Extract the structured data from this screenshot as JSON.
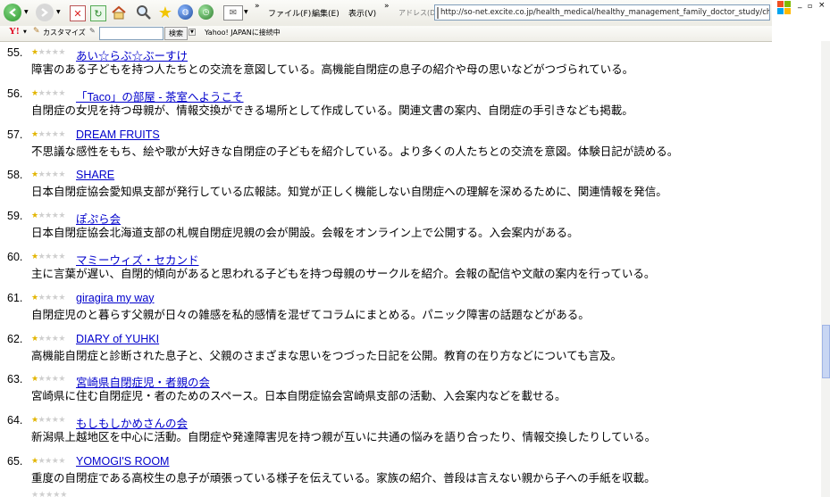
{
  "toolbar": {
    "menus": [
      "ファイル(F)",
      "編集(E)",
      "表示(V)"
    ],
    "address_label": "アドレス(D)",
    "address_url": "http://so-net.excite.co.jp/health_medical/healthy_management_family_doctor_study/chik",
    "customize_label": "カスタマイズ",
    "search_button": "検索",
    "yahoo_status": "Yahoo! JAPANに接続中"
  },
  "entries": [
    {
      "num": "55.",
      "rating": 1,
      "title": "あい☆らぶ☆ぶーすけ",
      "desc": "障害のある子どもを持つ人たちとの交流を意図している。高機能自閉症の息子の紹介や母の思いなどがつづられている。"
    },
    {
      "num": "56.",
      "rating": 1,
      "title": "「Taco」の部屋 ‐ 茶室へようこそ",
      "desc": "自閉症の女児を持つ母親が、情報交換ができる場所として作成している。関連文書の案内、自閉症の手引きなども掲載。"
    },
    {
      "num": "57.",
      "rating": 1,
      "title": "DREAM FRUITS",
      "desc": "不思議な感性をもち、絵や歌が大好きな自閉症の子どもを紹介している。より多くの人たちとの交流を意図。体験日記が読める。"
    },
    {
      "num": "58.",
      "rating": 1,
      "title": "SHARE",
      "desc": "日本自閉症協会愛知県支部が発行している広報誌。知覚が正しく機能しない自閉症への理解を深めるために、関連情報を発信。"
    },
    {
      "num": "59.",
      "rating": 1,
      "title": "ぽぷら会",
      "desc": "日本自閉症協会北海道支部の札幌自閉症児親の会が開設。会報をオンライン上で公開する。入会案内がある。"
    },
    {
      "num": "60.",
      "rating": 1,
      "title": "マミーウィズ・セカンド",
      "desc": "主に言葉が遅い、自閉的傾向があると思われる子どもを持つ母親のサークルを紹介。会報の配信や文献の案内を行っている。"
    },
    {
      "num": "61.",
      "rating": 1,
      "title": "giragira my way",
      "desc": "自閉症児のと暮らす父親が日々の雑感を私的感情を混ぜてコラムにまとめる。パニック障害の話題などがある。"
    },
    {
      "num": "62.",
      "rating": 1,
      "title": "DIARY of YUHKI",
      "desc": "高機能自閉症と診断された息子と、父親のさまざまな思いをつづった日記を公開。教育の在り方などについても言及。"
    },
    {
      "num": "63.",
      "rating": 1,
      "title": "宮崎県自閉症児・者親の会",
      "desc": "宮崎県に住む自閉症児・者のためのスペース。日本自閉症協会宮崎県支部の活動、入会案内などを載せる。"
    },
    {
      "num": "64.",
      "rating": 1,
      "title": "もしもしかめさんの会",
      "desc": "新潟県上越地区を中心に活動。自閉症や発達障害児を持つ親が互いに共通の悩みを語り合ったり、情報交換したりしている。"
    },
    {
      "num": "65.",
      "rating": 1,
      "title": "YOMOGI'S ROOM",
      "desc": "重度の自閉症である高校生の息子が頑張っている様子を伝えている。家族の紹介、普段は言えない親から子への手紙を収載。"
    }
  ]
}
